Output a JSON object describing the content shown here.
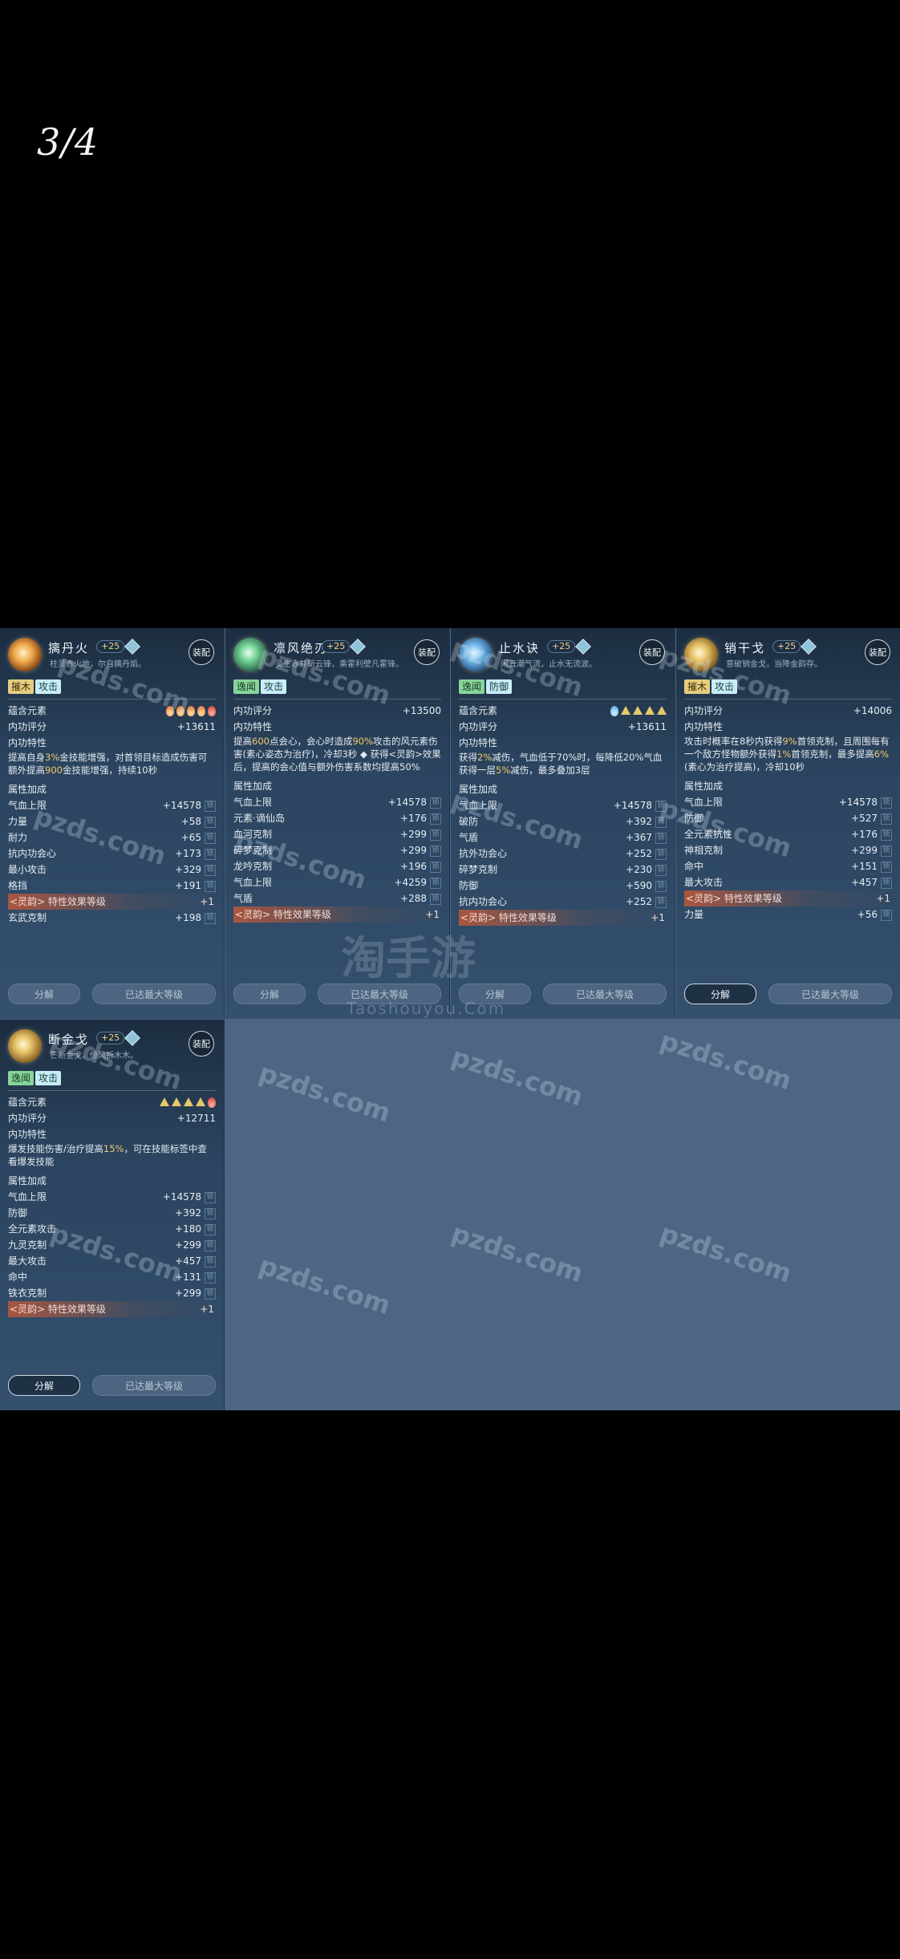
{
  "page_label": "3/4",
  "equip_label": "装配",
  "attr_title": "属性加成",
  "inner_score_label": "内功评分",
  "trait_title": "内功特性",
  "element_label": "蕴含元素",
  "disassemble_label": "分解",
  "max_level_label": "已达最大等级",
  "watermark": "pzds.com",
  "watermark_center": "淘手游",
  "watermark_sub": "Taoshouyou.Com",
  "cards": [
    {
      "name": "摛丹火",
      "level": "+25",
      "desc": "柱灵赤火地，尔自摛丹焰。",
      "icon": "flame-icon",
      "tags": [
        "摧木",
        "攻击"
      ],
      "score": "+13611",
      "elements": [
        "fire",
        "fire",
        "fire",
        "fire",
        "red"
      ],
      "trait": [
        "提高自身",
        "3%",
        "金技能增强，对首领目标造成伤害可额外提高",
        "900",
        "金技能增强，持续10秒"
      ],
      "attrs": [
        [
          "气血上限",
          "+14578"
        ],
        [
          "力量",
          "+58"
        ],
        [
          "耐力",
          "+65"
        ],
        [
          "抗内功会心",
          "+173"
        ],
        [
          "最小攻击",
          "+329"
        ],
        [
          "格挡",
          "+191"
        ]
      ],
      "spirit": [
        "<灵韵> 特性效果等级",
        "+1"
      ],
      "last": [
        "玄武克制",
        "+198"
      ]
    },
    {
      "name": "凛风绝刃",
      "level": "+25",
      "desc": "灵生赤并斩云锋，乘霍利壁凡霍锋。",
      "icon": "wind-icon",
      "tags": [
        "逸闻",
        "攻击"
      ],
      "score": "+13500",
      "elements": [],
      "trait": [
        "提高",
        "600",
        "点会心，会心时造成",
        "90%",
        "攻击的风元素伤害(素心姿态为治疗)，冷却3秒 ◆ 获得<灵韵>效果后，提高的会心值与额外伤害系数均提高50%"
      ],
      "attrs": [
        [
          "气血上限",
          "+14578"
        ],
        [
          "元素·谪仙岛",
          "+176"
        ],
        [
          "血河克制",
          "+299"
        ],
        [
          "碎梦克制",
          "+299"
        ],
        [
          "龙吟克制",
          "+196"
        ],
        [
          "气血上限",
          "+4259"
        ],
        [
          "气盾",
          "+288"
        ]
      ],
      "spirit": [
        "<灵韵> 特性效果等级",
        "+1"
      ],
      "last": null
    },
    {
      "name": "止水诀",
      "level": "+25",
      "desc": "闲云潮气流，止水无流波。",
      "icon": "water-icon",
      "tags": [
        "逸闻",
        "防御"
      ],
      "score": "+13611",
      "elements": [
        "water",
        "gold",
        "gold",
        "gold",
        "gold"
      ],
      "trait": [
        "获得",
        "2%",
        "减伤，气血低于70%时，每降低20%气血获得一层",
        "5%",
        "减伤，最多叠加3层"
      ],
      "attrs": [
        [
          "气血上限",
          "+14578"
        ],
        [
          "破防",
          "+392"
        ],
        [
          "气盾",
          "+367"
        ],
        [
          "抗外功会心",
          "+252"
        ],
        [
          "碎梦克制",
          "+230"
        ],
        [
          "防御",
          "+590"
        ],
        [
          "抗内功会心",
          "+252"
        ]
      ],
      "spirit": [
        "<灵韵> 特性效果等级",
        "+1"
      ],
      "last": null
    },
    {
      "name": "销干戈",
      "level": "+25",
      "desc": "意破销金戈，当降金韵存。",
      "icon": "gold-icon",
      "tags": [
        "摧木",
        "攻击"
      ],
      "score": "+14006",
      "elements": [],
      "trait": [
        "攻击时概率在8秒内获得",
        "9%",
        "首领克制，且周围每有一个敌方怪物额外获得",
        "1%",
        "首领克制，最多提高",
        "6%",
        "(素心为治疗提高)，冷却10秒"
      ],
      "attrs": [
        [
          "气血上限",
          "+14578"
        ],
        [
          "防御",
          "+527"
        ],
        [
          "全元素抗性",
          "+176"
        ],
        [
          "神相克制",
          "+299"
        ],
        [
          "命中",
          "+151"
        ],
        [
          "最大攻击",
          "+457"
        ]
      ],
      "spirit": [
        "<灵韵> 特性效果等级",
        "+1"
      ],
      "last": [
        "力量",
        "+56"
      ]
    },
    {
      "name": "断金戈",
      "level": "+25",
      "desc": "芒断金戈，惊风折木木。",
      "icon": "gold-icon",
      "tags": [
        "逸闻",
        "攻击"
      ],
      "score": "+12711",
      "elements": [
        "gold",
        "gold",
        "gold",
        "gold",
        "red"
      ],
      "trait": [
        "爆发技能伤害/治疗提高",
        "15%",
        "，可在技能标签中查看爆发技能"
      ],
      "attrs": [
        [
          "气血上限",
          "+14578"
        ],
        [
          "防御",
          "+392"
        ],
        [
          "全元素攻击",
          "+180"
        ],
        [
          "九灵克制",
          "+299"
        ],
        [
          "最大攻击",
          "+457"
        ],
        [
          "命中",
          "+131"
        ],
        [
          "铁衣克制",
          "+299"
        ]
      ],
      "spirit": [
        "<灵韵> 特性效果等级",
        "+1"
      ],
      "last": null
    }
  ],
  "colors": {
    "panel_bg": "#4d6683",
    "highlight": "#f2c86a",
    "spirit": "#d25a32"
  }
}
